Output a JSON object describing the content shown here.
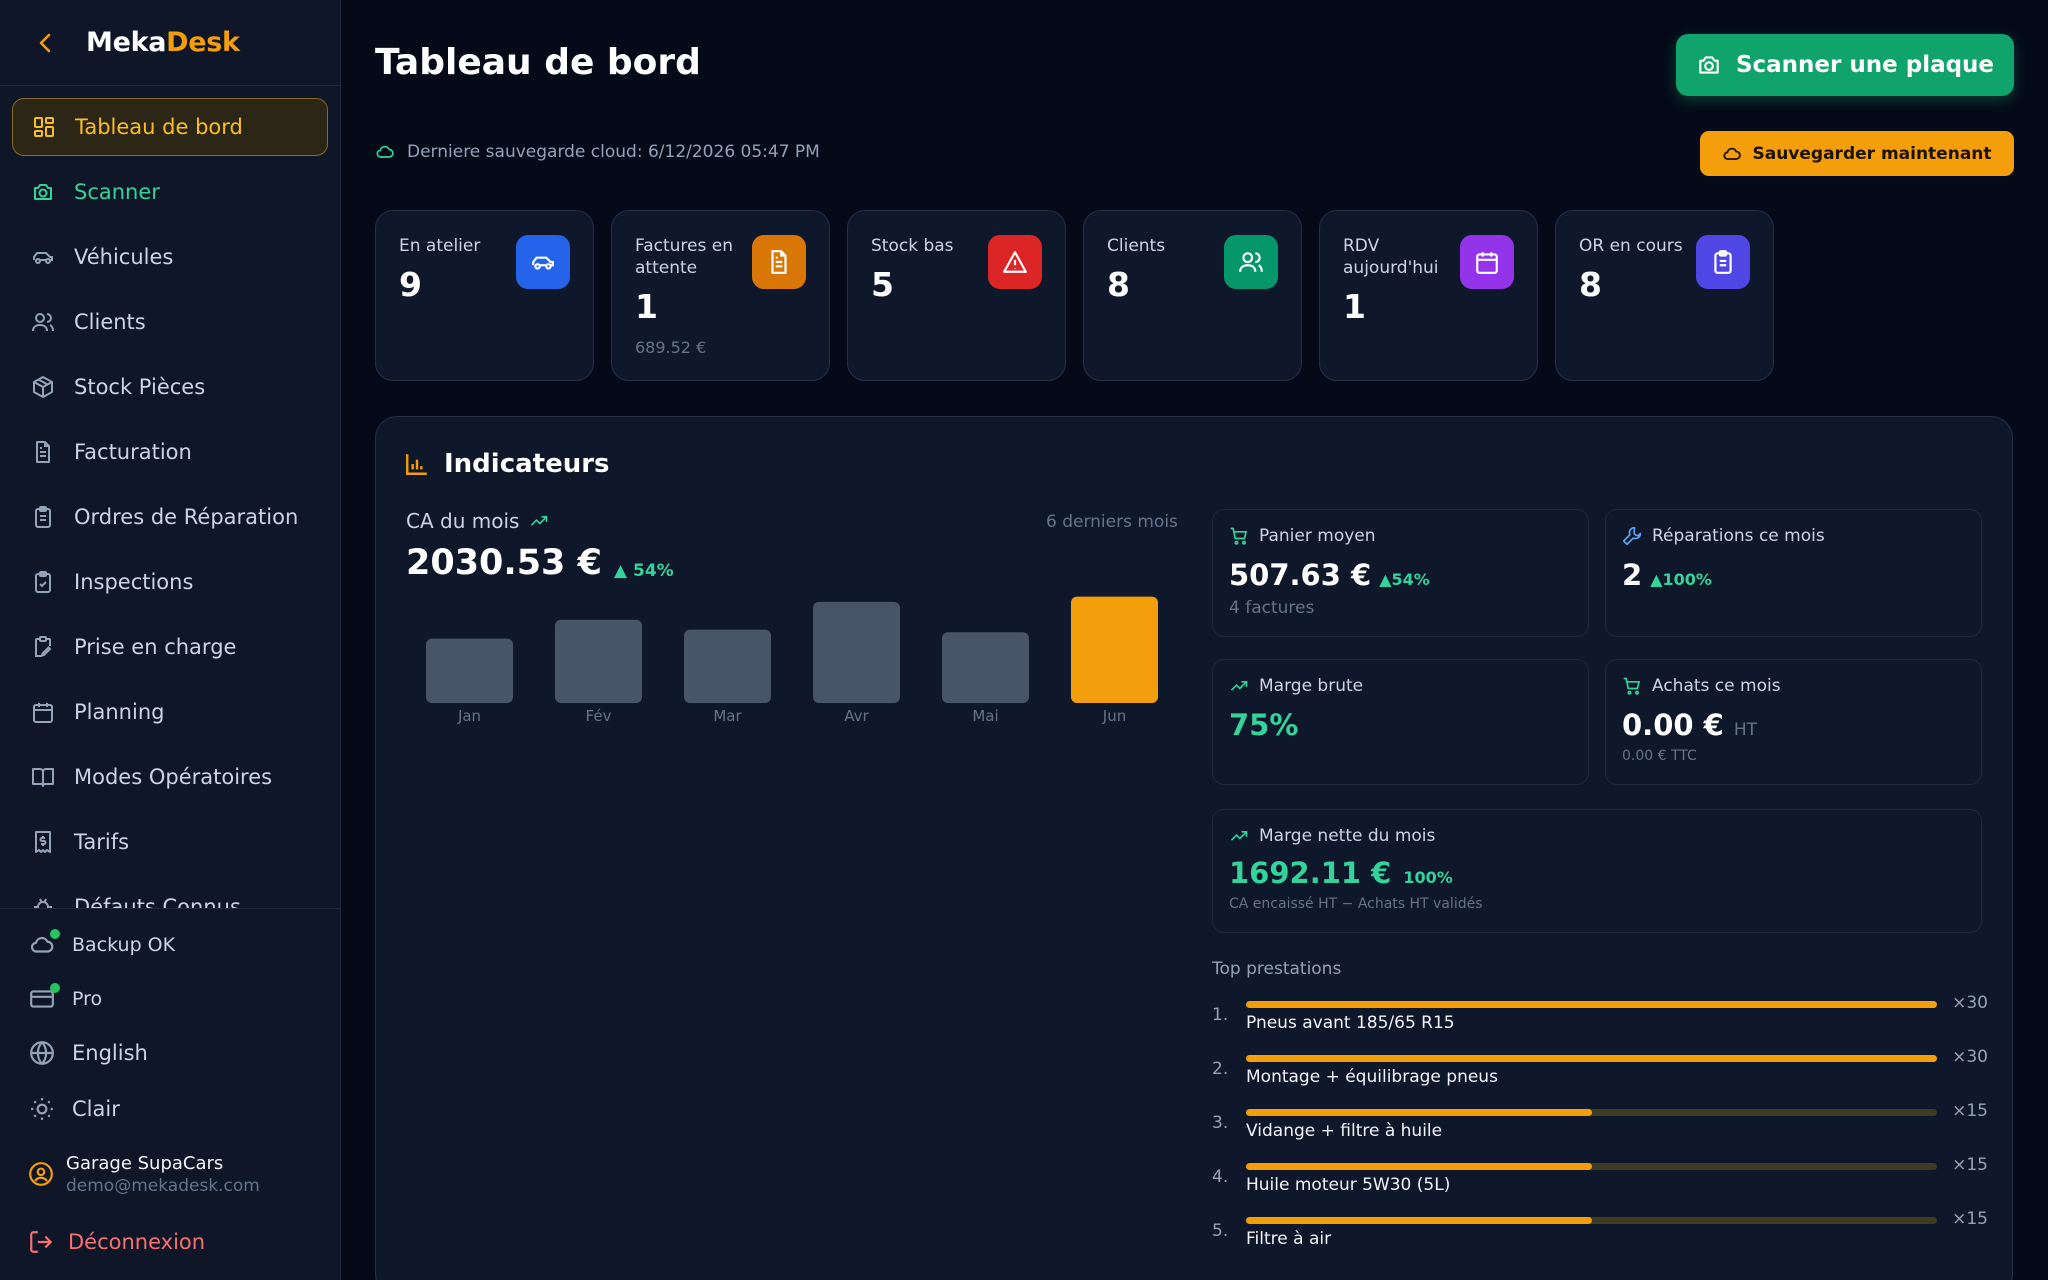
{
  "brand": {
    "part1": "Meka",
    "part2": "Desk"
  },
  "nav": [
    {
      "label": "Tableau de bord",
      "icon": "dashboard-icon"
    },
    {
      "label": "Scanner",
      "icon": "camera-icon"
    },
    {
      "label": "Véhicules",
      "icon": "car-icon"
    },
    {
      "label": "Clients",
      "icon": "users-icon"
    },
    {
      "label": "Stock Pièces",
      "icon": "box-icon"
    },
    {
      "label": "Facturation",
      "icon": "file-icon"
    },
    {
      "label": "Ordres de Réparation",
      "icon": "clipboard-icon"
    },
    {
      "label": "Inspections",
      "icon": "clipboard-check-icon"
    },
    {
      "label": "Prise en charge",
      "icon": "clipboard-pen-icon"
    },
    {
      "label": "Planning",
      "icon": "calendar-icon"
    },
    {
      "label": "Modes Opératoires",
      "icon": "book-icon"
    },
    {
      "label": "Tarifs",
      "icon": "receipt-icon"
    },
    {
      "label": "Défauts Connus",
      "icon": "bug-icon"
    }
  ],
  "footer": {
    "backup": "Backup OK",
    "plan": "Pro",
    "language": "English",
    "theme": "Clair",
    "user_name": "Garage SupaCars",
    "user_email": "demo@mekadesk.com",
    "logout": "Déconnexion"
  },
  "header": {
    "title": "Tableau de bord",
    "scan_button": "Scanner une plaque",
    "save_status": "Derniere sauvegarde cloud: 6/12/2026 05:47 PM",
    "save_button": "Sauvegarder maintenant"
  },
  "stats": [
    {
      "label": "En atelier",
      "value": "9",
      "sub": "",
      "color": "#2563eb",
      "icon": "car-icon"
    },
    {
      "label": "Factures en attente",
      "value": "1",
      "sub": "689.52 €",
      "color": "#d97706",
      "icon": "file-icon"
    },
    {
      "label": "Stock bas",
      "value": "5",
      "sub": "",
      "color": "#dc2626",
      "icon": "alert-triangle-icon"
    },
    {
      "label": "Clients",
      "value": "8",
      "sub": "",
      "color": "#059669",
      "icon": "users-icon"
    },
    {
      "label": "RDV aujourd'hui",
      "value": "1",
      "sub": "",
      "color": "#9333ea",
      "icon": "calendar-icon"
    },
    {
      "label": "OR en cours",
      "value": "8",
      "sub": "",
      "color": "#4f46e5",
      "icon": "clipboard-icon"
    }
  ],
  "indicators": {
    "title": "Indicateurs",
    "ca_label": "CA du mois",
    "ca_period": "6 derniers mois",
    "ca_value": "2030.53 €",
    "ca_growth": "▲ 54%",
    "panier_label": "Panier moyen",
    "panier_value": "507.63 €",
    "panier_growth": "▲54%",
    "panier_note": "4 factures",
    "reparations_label": "Réparations ce mois",
    "reparations_value": "2",
    "reparations_growth": "▲100%",
    "marge_brute_label": "Marge brute",
    "marge_brute_value": "75%",
    "achats_label": "Achats ce mois",
    "achats_value": "0.00 €",
    "achats_unit": "HT",
    "achats_ttc": "0.00 € TTC",
    "marge_nette_label": "Marge nette du mois",
    "marge_nette_value": "1692.11 €",
    "marge_nette_pct": "100%",
    "marge_nette_note": "CA encaissé HT − Achats HT validés",
    "top_label": "Top prestations",
    "top": [
      {
        "rank": "1.",
        "name": "Pneus avant 185/65 R15",
        "count": "×30",
        "share": 1.0
      },
      {
        "rank": "2.",
        "name": "Montage + équilibrage pneus",
        "count": "×30",
        "share": 1.0
      },
      {
        "rank": "3.",
        "name": "Vidange + filtre à huile",
        "count": "×15",
        "share": 0.5
      },
      {
        "rank": "4.",
        "name": "Huile moteur 5W30 (5L)",
        "count": "×15",
        "share": 0.5
      },
      {
        "rank": "5.",
        "name": "Filtre à air",
        "count": "×15",
        "share": 0.5
      }
    ]
  },
  "chart_data": {
    "type": "bar",
    "categories": [
      "Jan",
      "Fév",
      "Mar",
      "Avr",
      "Mai",
      "Jun"
    ],
    "values": [
      1230,
      1590,
      1400,
      1930,
      1350,
      2030.53
    ],
    "highlight_index": 5,
    "colors": {
      "bar": "#475569",
      "highlight": "#f59e0b"
    },
    "ylim": [
      0,
      2100
    ]
  }
}
